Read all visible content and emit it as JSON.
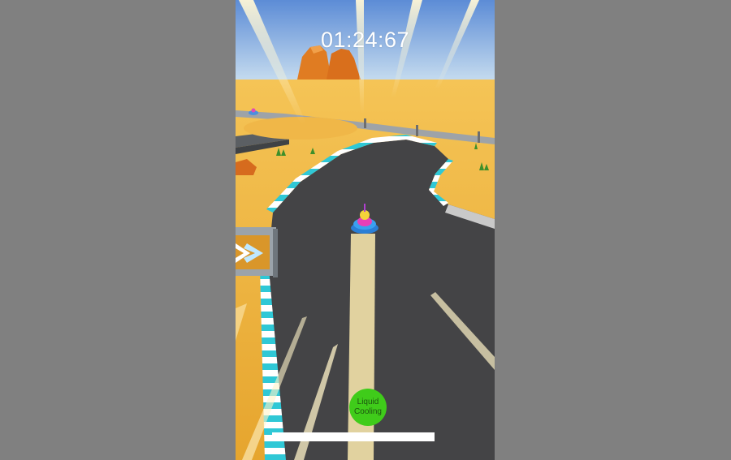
{
  "hud": {
    "race_timer": "01:24:67",
    "ability_button": {
      "line1": "Liquid",
      "line2": "Cooling",
      "color": "#3fcc1a"
    },
    "progress": 1.0
  },
  "colors": {
    "outer_background": "#808080",
    "sky_top": "#5f8fd6",
    "sand": "#f1b33c",
    "track": "#444446",
    "curb_a": "#2fc8d6",
    "curb_b": "#ffffff"
  },
  "icons": {
    "direction_sign": "chevron-right-icon",
    "player_kart": "kart-icon",
    "opponent_kart": "kart-icon"
  }
}
